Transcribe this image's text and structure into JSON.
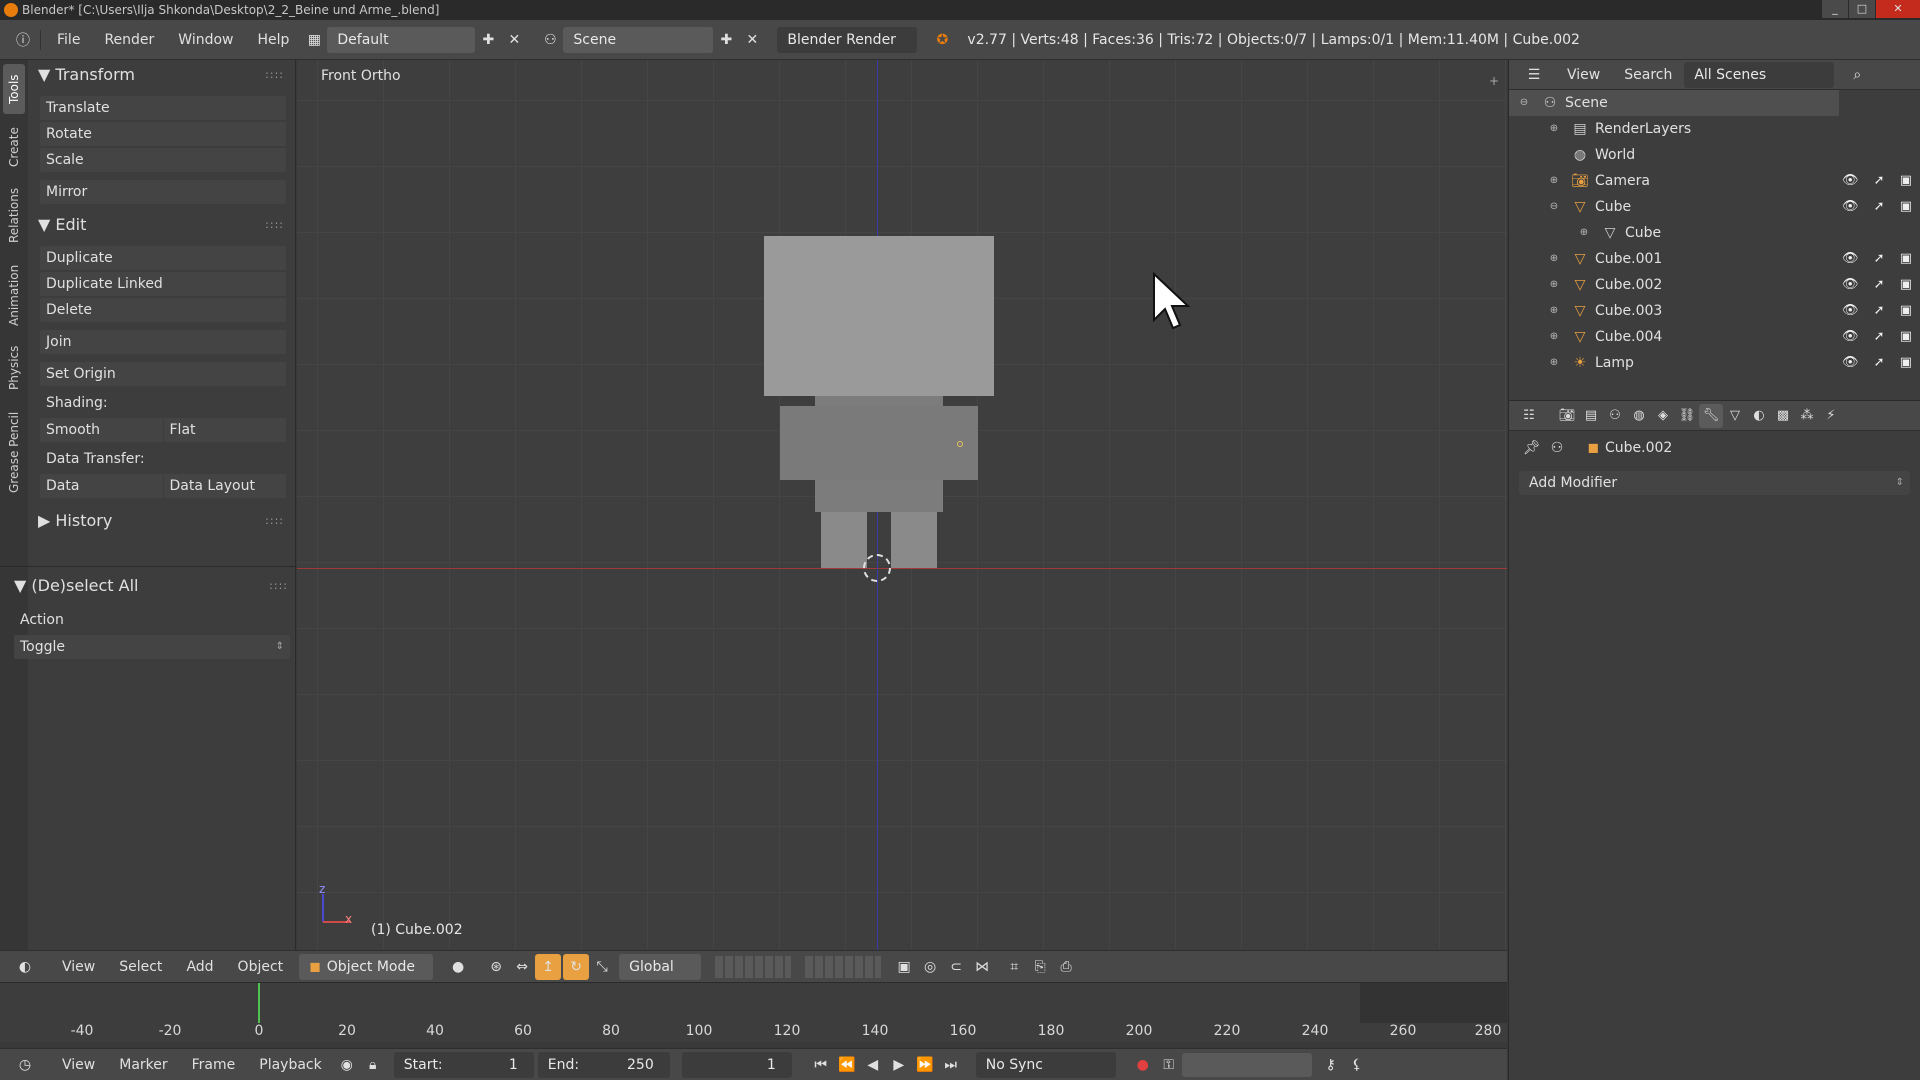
{
  "titlebar": {
    "title": "Blender* [C:\\Users\\Ilja Shkonda\\Desktop\\2_2_Beine und Arme_.blend]"
  },
  "infobar": {
    "menus": [
      "File",
      "Render",
      "Window",
      "Help"
    ],
    "screen_layout": "Default",
    "scene": "Scene",
    "render_engine": "Blender Render",
    "stats": "v2.77 | Verts:48 | Faces:36 | Tris:72 | Objects:0/7 | Lamps:0/1 | Mem:11.40M | Cube.002"
  },
  "toolshelf": {
    "tabs": [
      "Tools",
      "Create",
      "Relations",
      "Animation",
      "Physics",
      "Grease Pencil"
    ],
    "transform": {
      "title": "Transform",
      "buttons": [
        "Translate",
        "Rotate",
        "Scale",
        "Mirror"
      ]
    },
    "edit": {
      "title": "Edit",
      "buttons": [
        "Duplicate",
        "Duplicate Linked",
        "Delete",
        "Join",
        "Set Origin"
      ],
      "shading_label": "Shading:",
      "shading_buttons": [
        "Smooth",
        "Flat"
      ],
      "data_transfer_label": "Data Transfer:",
      "data_transfer_buttons": [
        "Data",
        "Data Layout"
      ]
    },
    "history": {
      "title": "History"
    },
    "deselect": {
      "title": "(De)select All",
      "action_label": "Action",
      "action_value": "Toggle"
    }
  },
  "viewport": {
    "view_name": "Front Ortho",
    "active_object": "(1) Cube.002",
    "axis_z": "z",
    "axis_x": "x"
  },
  "viewhdr": {
    "menus": [
      "View",
      "Select",
      "Add",
      "Object"
    ],
    "mode": "Object Mode",
    "orientation": "Global"
  },
  "timeline": {
    "ruler": [
      "-40",
      "-20",
      "0",
      "20",
      "40",
      "60",
      "80",
      "100",
      "120",
      "140",
      "160",
      "180",
      "200",
      "220",
      "240",
      "260",
      "280"
    ],
    "menus": [
      "View",
      "Marker",
      "Frame",
      "Playback"
    ],
    "start_label": "Start:",
    "start_value": "1",
    "end_label": "End:",
    "end_value": "250",
    "current_frame": "1",
    "sync": "No Sync"
  },
  "outliner": {
    "header": {
      "view": "View",
      "search": "Search",
      "scenes": "All Scenes"
    },
    "rows": [
      {
        "label": "Scene",
        "indent": 0,
        "icon": "scene-icon",
        "expand": "⊖",
        "ctrls": false,
        "selected": true
      },
      {
        "label": "RenderLayers",
        "indent": 1,
        "icon": "renderlayers-icon",
        "expand": "⊕",
        "ctrls": false
      },
      {
        "label": "World",
        "indent": 1,
        "icon": "world-icon",
        "expand": "",
        "ctrls": false
      },
      {
        "label": "Camera",
        "indent": 1,
        "icon": "camera-icon",
        "expand": "⊕",
        "ctrls": true
      },
      {
        "label": "Cube",
        "indent": 1,
        "icon": "mesh-icon",
        "expand": "⊖",
        "ctrls": true
      },
      {
        "label": "Cube",
        "indent": 2,
        "icon": "mesh-data-icon",
        "expand": "⊕",
        "ctrls": false
      },
      {
        "label": "Cube.001",
        "indent": 1,
        "icon": "mesh-icon",
        "expand": "⊕",
        "ctrls": true
      },
      {
        "label": "Cube.002",
        "indent": 1,
        "icon": "mesh-icon",
        "expand": "⊕",
        "ctrls": true
      },
      {
        "label": "Cube.003",
        "indent": 1,
        "icon": "mesh-icon",
        "expand": "⊕",
        "ctrls": true
      },
      {
        "label": "Cube.004",
        "indent": 1,
        "icon": "mesh-icon",
        "expand": "⊕",
        "ctrls": true
      },
      {
        "label": "Lamp",
        "indent": 1,
        "icon": "lamp-icon",
        "expand": "⊕",
        "ctrls": true
      }
    ]
  },
  "properties": {
    "context_object": "Cube.002",
    "add_modifier": "Add Modifier"
  },
  "colors": {
    "accent": "#e87d0d",
    "x_axis": "#a03a3a",
    "z_axis": "#3a3aa8",
    "mesh_fill": "#9a9a9a",
    "mesh_selected": "#7a7a7a",
    "frame_marker": "#4fc34f"
  }
}
